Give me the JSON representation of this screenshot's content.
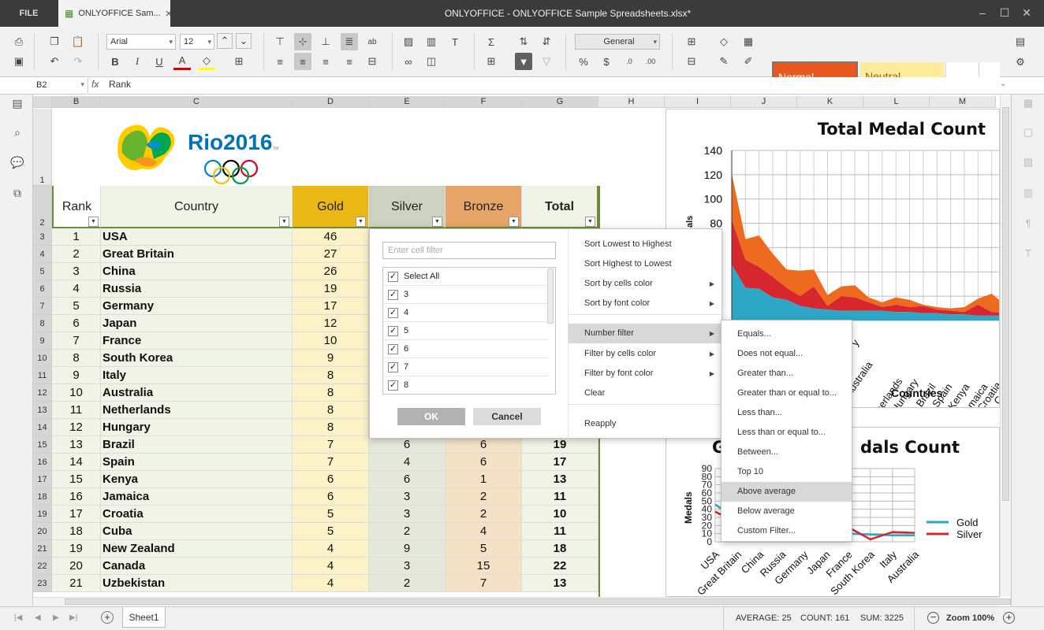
{
  "titlebar": {
    "file_label": "FILE",
    "tab_label": "ONLYOFFICE Sam...",
    "title": "ONLYOFFICE - ONLYOFFICE Sample Spreadsheets.xlsx*"
  },
  "toolbar": {
    "font_name": "Arial",
    "font_size": "12",
    "number_format": "General",
    "style_normal": "Normal",
    "style_neutral": "Neutral"
  },
  "formula_bar": {
    "cell_ref": "B2",
    "fx": "fx",
    "value": "Rank"
  },
  "columns": [
    "B",
    "C",
    "D",
    "E",
    "F",
    "G",
    "H",
    "I",
    "J",
    "K",
    "L",
    "M"
  ],
  "rows": [
    "1",
    "2",
    "3",
    "4",
    "5",
    "6",
    "7",
    "8",
    "9",
    "10",
    "11",
    "12",
    "13",
    "14",
    "15",
    "16",
    "17",
    "18",
    "19",
    "20",
    "21",
    "22",
    "23"
  ],
  "table": {
    "headers": {
      "rank": "Rank",
      "country": "Country",
      "gold": "Gold",
      "silver": "Silver",
      "bronze": "Bronze",
      "total": "Total"
    },
    "data": [
      [
        "1",
        "USA",
        "46",
        "",
        "",
        ""
      ],
      [
        "2",
        "Great Britain",
        "27",
        "",
        "",
        ""
      ],
      [
        "3",
        "China",
        "26",
        "",
        "",
        ""
      ],
      [
        "4",
        "Russia",
        "19",
        "",
        "",
        ""
      ],
      [
        "5",
        "Germany",
        "17",
        "",
        "",
        ""
      ],
      [
        "6",
        "Japan",
        "12",
        "",
        "",
        ""
      ],
      [
        "7",
        "France",
        "10",
        "",
        "",
        ""
      ],
      [
        "8",
        "South Korea",
        "9",
        "",
        "",
        ""
      ],
      [
        "9",
        "Italy",
        "8",
        "",
        "",
        ""
      ],
      [
        "10",
        "Australia",
        "8",
        "",
        "",
        ""
      ],
      [
        "11",
        "Netherlands",
        "8",
        "",
        "",
        ""
      ],
      [
        "12",
        "Hungary",
        "8",
        "",
        "",
        ""
      ],
      [
        "13",
        "Brazil",
        "7",
        "6",
        "6",
        "19"
      ],
      [
        "14",
        "Spain",
        "7",
        "4",
        "6",
        "17"
      ],
      [
        "15",
        "Kenya",
        "6",
        "6",
        "1",
        "13"
      ],
      [
        "16",
        "Jamaica",
        "6",
        "3",
        "2",
        "11"
      ],
      [
        "17",
        "Croatia",
        "5",
        "3",
        "2",
        "10"
      ],
      [
        "18",
        "Cuba",
        "5",
        "2",
        "4",
        "11"
      ],
      [
        "19",
        "New Zealand",
        "4",
        "9",
        "5",
        "18"
      ],
      [
        "20",
        "Canada",
        "4",
        "3",
        "15",
        "22"
      ],
      [
        "21",
        "Uzbekistan",
        "4",
        "2",
        "7",
        "13"
      ]
    ]
  },
  "logo": {
    "text": "Rio2016",
    "tm": "TM"
  },
  "chart1": {
    "title": "Total Medal Count",
    "xlabel": "Countries",
    "ylabel_partial": "als",
    "y_ticks": [
      "140",
      "120",
      "100",
      "80",
      "60",
      "40",
      "20",
      "0"
    ],
    "x_labels_visible": [
      "y",
      "Australia",
      "Netherlands",
      "Hungary",
      "Brazil",
      "Spain",
      "Kenya",
      "Jamaica",
      "Croatia",
      "Cuba",
      "New Zealand",
      "C"
    ]
  },
  "chart2": {
    "title_left": "G",
    "title_right": "dals Count",
    "ylabel": "Medals",
    "y_ticks": [
      "90",
      "80",
      "70",
      "60",
      "50",
      "40",
      "30",
      "20",
      "10",
      "0"
    ],
    "x_labels": [
      "USA",
      "Great Britain",
      "China",
      "Russia",
      "Germany",
      "Japan",
      "France",
      "South Korea",
      "Italy",
      "Australia"
    ],
    "legend": [
      {
        "name": "Gold",
        "color": "#2ea7c6"
      },
      {
        "name": "Silver",
        "color": "#d7262e"
      }
    ]
  },
  "chart_data": [
    {
      "type": "area",
      "title": "Total Medal Count",
      "xlabel": "Countries",
      "ylim": [
        0,
        140
      ],
      "categories": [
        "USA",
        "Great Britain",
        "China",
        "Russia",
        "Germany",
        "Japan",
        "France",
        "South Korea",
        "Italy",
        "Australia",
        "Netherlands",
        "Hungary",
        "Brazil",
        "Spain",
        "Kenya",
        "Jamaica",
        "Croatia",
        "Cuba",
        "New Zealand",
        "Canada",
        "Uzbekistan"
      ],
      "series": [
        {
          "values": [
            46,
            27,
            26,
            19,
            17,
            12,
            10,
            9,
            8,
            8,
            8,
            8,
            7,
            7,
            6,
            6,
            5,
            5,
            4,
            4,
            4
          ],
          "color": "#2ea7c6"
        },
        {
          "values": [
            37,
            23,
            18,
            17,
            10,
            8,
            18,
            3,
            12,
            11,
            7,
            3,
            6,
            4,
            6,
            3,
            3,
            2,
            9,
            3,
            2
          ],
          "color": "#d7262e"
        },
        {
          "values": [
            38,
            17,
            26,
            19,
            15,
            21,
            14,
            9,
            8,
            10,
            4,
            4,
            6,
            6,
            1,
            2,
            2,
            4,
            5,
            15,
            7
          ],
          "color": "#ed6a1e"
        }
      ]
    },
    {
      "type": "line",
      "title": "",
      "ylabel": "Medals",
      "ylim": [
        0,
        90
      ],
      "categories": [
        "USA",
        "Great Britain",
        "China",
        "Russia",
        "Germany",
        "Japan",
        "France",
        "South Korea",
        "Italy",
        "Australia"
      ],
      "series": [
        {
          "name": "Gold",
          "values": [
            46,
            27,
            26,
            19,
            17,
            12,
            10,
            9,
            8,
            8
          ],
          "color": "#2ea7c6"
        },
        {
          "name": "Silver",
          "values": [
            37,
            23,
            18,
            17,
            10,
            8,
            18,
            3,
            12,
            11
          ],
          "color": "#d7262e"
        }
      ]
    }
  ],
  "filter": {
    "search_placeholder": "Enter cell filter",
    "items": [
      "Select All",
      "3",
      "4",
      "5",
      "6",
      "7",
      "8"
    ],
    "ok": "OK",
    "cancel": "Cancel",
    "menu": [
      "Sort Lowest to Highest",
      "Sort Highest to Lowest",
      "Sort by cells color",
      "Sort by font color",
      "Number filter",
      "Filter by cells color",
      "Filter by font color",
      "Clear",
      "Reapply"
    ],
    "submenu": [
      "Equals...",
      "Does not equal...",
      "Greater than...",
      "Greater than or equal to...",
      "Less than...",
      "Less than or equal to...",
      "Between...",
      "Top 10",
      "Above average",
      "Below average",
      "Custom Filter..."
    ]
  },
  "statusbar": {
    "sheet": "Sheet1",
    "average": "AVERAGE: 25",
    "count": "COUNT: 161",
    "sum": "SUM: 3225",
    "zoom": "Zoom 100%"
  }
}
